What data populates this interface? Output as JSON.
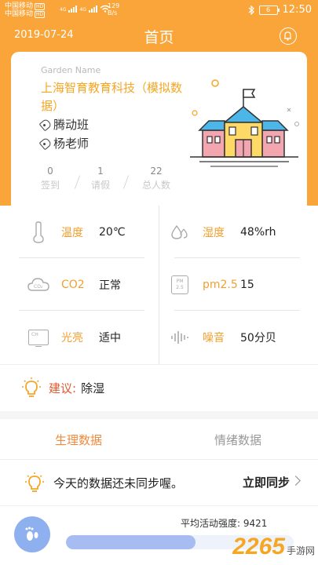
{
  "status_bar": {
    "carrier1": "中国移动",
    "carrier2": "中国移动",
    "hd": "HD",
    "net1": "4G",
    "net2": "4G",
    "speed_value": "129",
    "speed_unit": "B/s",
    "battery": "6",
    "time": "12:50"
  },
  "header": {
    "date": "2019-07-24",
    "title": "首页",
    "bell_icon": "bell-icon"
  },
  "garden": {
    "label": "Garden Name",
    "name": "上海智育教育科技（模拟数据）",
    "class_name": "腾动班",
    "teacher": "杨老师",
    "stats": [
      {
        "value": "0",
        "label": "签到"
      },
      {
        "value": "1",
        "label": "请假"
      },
      {
        "value": "22",
        "label": "总人数"
      }
    ],
    "illustration": "school-building-icon"
  },
  "sensors": {
    "temperature": {
      "label": "温度",
      "value": "20℃",
      "icon": "thermometer-icon"
    },
    "humidity": {
      "label": "湿度",
      "value": "48%rh",
      "icon": "water-drop-icon"
    },
    "co2": {
      "label": "CO2",
      "value": "正常",
      "icon": "co2-cloud-icon"
    },
    "pm25": {
      "label": "pm2.5",
      "value": "15",
      "icon_text_top": "PM",
      "icon_text_bottom": "2.5"
    },
    "light": {
      "label": "光亮",
      "value": "适中",
      "icon": "light-monitor-icon",
      "icon_text": "CH"
    },
    "noise": {
      "label": "噪音",
      "value": "50分贝",
      "icon": "sound-wave-icon"
    }
  },
  "suggestion": {
    "key": "建议:",
    "value": "除湿",
    "icon": "lightbulb-icon"
  },
  "tabs": [
    {
      "label": "生理数据",
      "active": true
    },
    {
      "label": "情绪数据",
      "active": false
    }
  ],
  "sync": {
    "message": "今天的数据还未同步喔。",
    "button": "立即同步"
  },
  "activity": {
    "label": "平均活动强度: 9421",
    "progress": 0.57,
    "icon": "footprint-icon"
  },
  "watermark": {
    "big": "2265",
    "small": "手游网"
  },
  "colors": {
    "accent": "#f9a53a",
    "label": "#f0a030",
    "warn": "#e4572e",
    "bar": "#a7bdf1"
  }
}
